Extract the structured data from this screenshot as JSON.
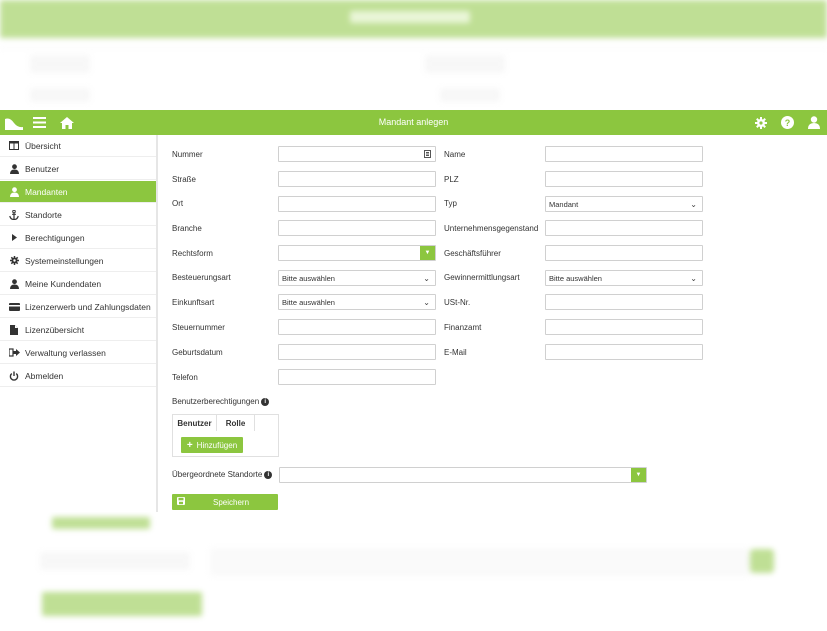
{
  "header": {
    "title": "Mandant anlegen"
  },
  "sidebar": {
    "items": [
      {
        "label": "Übersicht",
        "icon": "table-icon"
      },
      {
        "label": "Benutzer",
        "icon": "user-icon"
      },
      {
        "label": "Mandanten",
        "icon": "user-icon",
        "active": true
      },
      {
        "label": "Standorte",
        "icon": "anchor-icon"
      },
      {
        "label": "Berechtigungen",
        "icon": "caret-right-icon"
      },
      {
        "label": "Systemeinstellungen",
        "icon": "gear-icon"
      },
      {
        "label": "Meine Kundendaten",
        "icon": "user-icon"
      },
      {
        "label": "Lizenzerwerb und Zahlungsdaten",
        "icon": "credit-card-icon"
      },
      {
        "label": "Lizenzübersicht",
        "icon": "file-icon"
      },
      {
        "label": "Verwaltung verlassen",
        "icon": "sign-out-icon"
      },
      {
        "label": "Abmelden",
        "icon": "power-icon"
      }
    ]
  },
  "form": {
    "nummer": {
      "label": "Nummer",
      "value": ""
    },
    "name": {
      "label": "Name",
      "value": ""
    },
    "strasse": {
      "label": "Straße",
      "value": ""
    },
    "plz": {
      "label": "PLZ",
      "value": ""
    },
    "ort": {
      "label": "Ort",
      "value": ""
    },
    "typ": {
      "label": "Typ",
      "value": "Mandant"
    },
    "branche": {
      "label": "Branche",
      "value": ""
    },
    "unternehmensgegenstand": {
      "label": "Unternehmensgegenstand",
      "value": ""
    },
    "rechtsform": {
      "label": "Rechtsform",
      "value": ""
    },
    "geschaeftsfuehrer": {
      "label": "Geschäftsführer",
      "value": ""
    },
    "besteuerungsart": {
      "label": "Besteuerungsart",
      "value": "Bitte auswählen"
    },
    "gewinnermittlungsart": {
      "label": "Gewinnermittlungsart",
      "value": "Bitte auswählen"
    },
    "einkunftsart": {
      "label": "Einkunftsart",
      "value": "Bitte auswählen"
    },
    "ustnr": {
      "label": "USt-Nr.",
      "value": ""
    },
    "steuernummer": {
      "label": "Steuernummer",
      "value": ""
    },
    "finanzamt": {
      "label": "Finanzamt",
      "value": ""
    },
    "geburtsdatum": {
      "label": "Geburtsdatum",
      "value": ""
    },
    "email": {
      "label": "E-Mail",
      "value": ""
    },
    "telefon": {
      "label": "Telefon",
      "value": ""
    },
    "benutzerberechtigungen": {
      "label": "Benutzerberechtigungen"
    },
    "perm_columns": [
      "Benutzer",
      "Rolle"
    ],
    "add_label": "Hinzufügen",
    "standorte": {
      "label": "Übergeordnete Standorte",
      "value": ""
    },
    "save_label": "Speichern"
  },
  "colors": {
    "accent": "#8cc63f"
  }
}
